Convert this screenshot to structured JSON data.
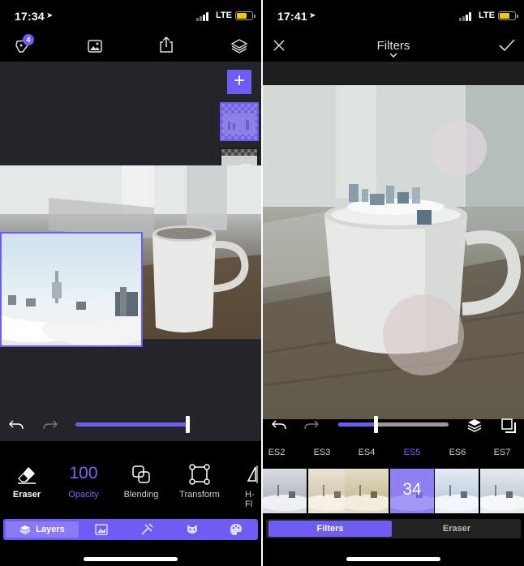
{
  "left": {
    "status": {
      "time": "17:34",
      "network": "LTE"
    },
    "topbar": {
      "badge_count": "4"
    },
    "add_label": "+",
    "tools": [
      {
        "label": "Eraser"
      },
      {
        "label": "Opacity",
        "value": "100"
      },
      {
        "label": "Blending"
      },
      {
        "label": "Transform"
      },
      {
        "label": "H-Fl"
      }
    ],
    "bottom_tabs": {
      "selected": "Layers"
    },
    "opacity_slider": {
      "value": 1.0
    }
  },
  "right": {
    "status": {
      "time": "17:41",
      "network": "LTE"
    },
    "title": "Filters",
    "filters": [
      {
        "name": "ES2"
      },
      {
        "name": "ES3"
      },
      {
        "name": "ES4"
      },
      {
        "name": "ES5",
        "value": "34",
        "selected": true
      },
      {
        "name": "ES6"
      },
      {
        "name": "ES7"
      }
    ],
    "segment": {
      "active": "Filters",
      "inactive": "Eraser"
    },
    "intensity_slider": {
      "value": 0.34
    }
  },
  "colors": {
    "accent": "#6f5cf2",
    "battery": "#f5c70a"
  }
}
